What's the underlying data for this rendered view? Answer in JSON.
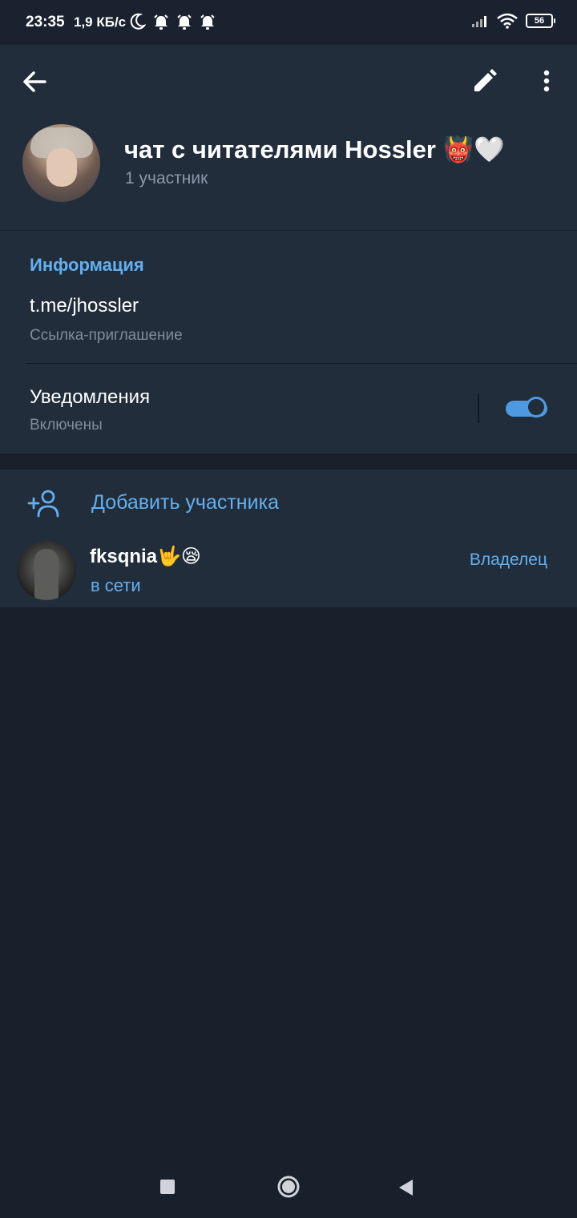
{
  "status_bar": {
    "time": "23:35",
    "speed": "1,9 КБ/с",
    "battery": "56",
    "icons": [
      "moon-icon",
      "alarm-icon",
      "alarm-icon",
      "alarm-icon",
      "signal-icon",
      "wifi-icon",
      "battery-icon"
    ]
  },
  "header": {
    "title": "чат с читателями Hossler 👹🤍",
    "subtitle": "1 участник",
    "icons": [
      "back-arrow-icon",
      "pencil-icon",
      "more-vertical-icon"
    ]
  },
  "info": {
    "section_title": "Информация",
    "link_value": "t.me/jhossler",
    "link_label": "Ссылка-приглашение",
    "notifications_title": "Уведомления",
    "notifications_state": "Включены",
    "notifications_enabled": true
  },
  "members": {
    "add_label": "Добавить участника",
    "list": [
      {
        "name": "fksqnia🤟😪",
        "status": "в сети",
        "role": "Владелец"
      }
    ]
  },
  "colors": {
    "background": "#18202c",
    "panel": "#212d3b",
    "accent": "#64aff0",
    "toggle": "#4d9ae0",
    "secondary_text": "#7f8c9b"
  }
}
